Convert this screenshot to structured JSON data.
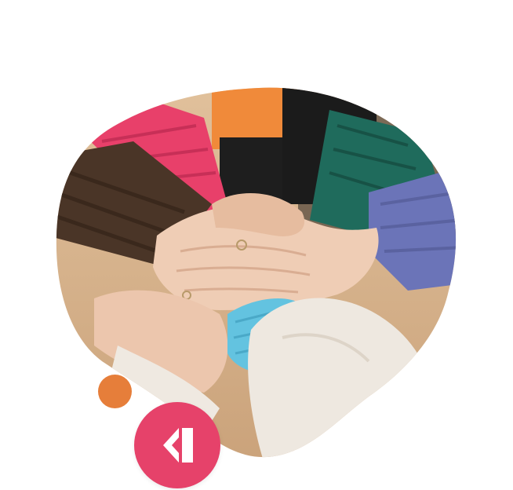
{
  "image": {
    "subject": "hands-stacked-photo",
    "colors": {
      "background": "#ffffff",
      "ground": "#d9b48c",
      "sleeve_pink": "#e8406a",
      "sleeve_brown": "#4a3527",
      "sleeve_orange": "#f08a3a",
      "sleeve_black": "#1e1e1e",
      "sleeve_green": "#1f6b5c",
      "sleeve_blue_purple": "#6b74b8",
      "sleeve_light_blue": "#63c3e0",
      "sleeve_cream": "#eee8e0",
      "skin": "#efcdb5",
      "skin_shadow": "#d9ad92"
    }
  },
  "decorations": {
    "accent_dot_color": "#e67e3a",
    "logo_badge_color": "#e6426a",
    "logo_icon": "k-logo-icon",
    "logo_mark_color": "#ffffff"
  }
}
